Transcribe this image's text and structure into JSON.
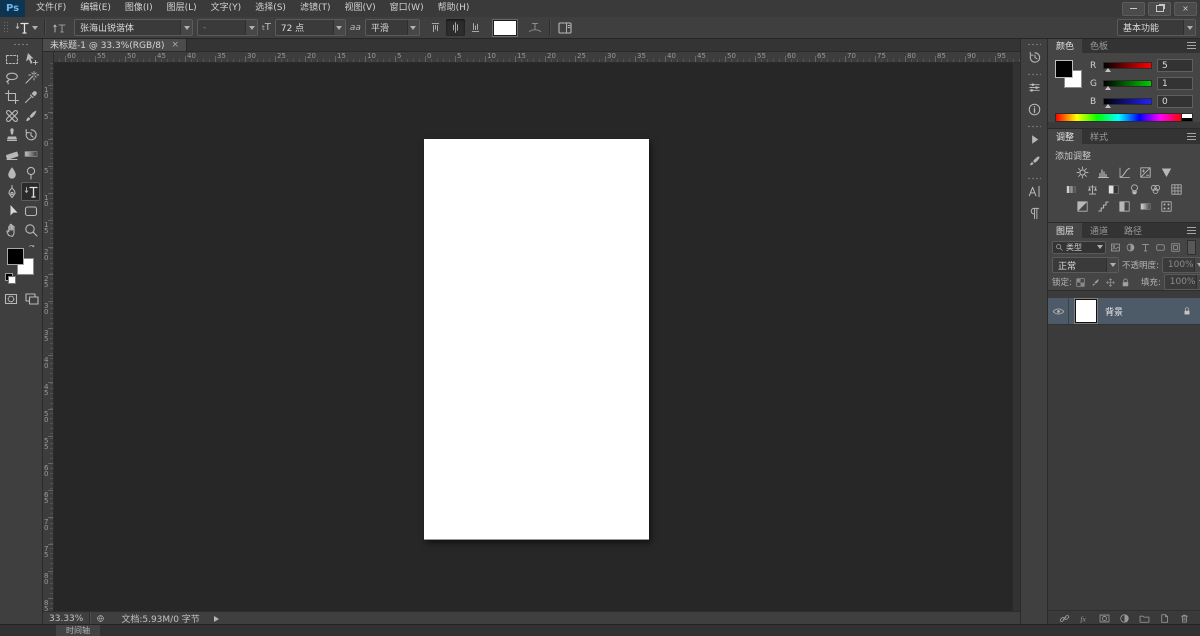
{
  "titlebar": {
    "logo": "Ps",
    "menus": [
      "文件(F)",
      "编辑(E)",
      "图像(I)",
      "图层(L)",
      "文字(Y)",
      "选择(S)",
      "滤镜(T)",
      "视图(V)",
      "窗口(W)",
      "帮助(H)"
    ],
    "window_buttons": [
      "minimize-icon",
      "restore-icon",
      "close-icon"
    ]
  },
  "options_bar": {
    "tool_icon": "type",
    "font_family": "张海山锐谐体",
    "font_style": "-",
    "size_icon_label": "tT",
    "font_size": "72 点",
    "anti_alias_icon_label": "aa",
    "anti_alias": "平滑",
    "alignment_icons": [
      "align-top-icon",
      "align-center-icon",
      "align-bottom-icon"
    ],
    "text_color": "#ffffff",
    "workspace": "基本功能"
  },
  "document_tab": {
    "title": "未标题-1 @ 33.3%(RGB/8)",
    "close_label": "×"
  },
  "toolbar": {
    "tools": [
      {
        "name": "rectangular-marquee"
      },
      {
        "name": "move"
      },
      {
        "name": "lasso"
      },
      {
        "name": "magic-wand"
      },
      {
        "name": "crop"
      },
      {
        "name": "eyedropper"
      },
      {
        "name": "healing-brush"
      },
      {
        "name": "brush"
      },
      {
        "name": "clone-stamp"
      },
      {
        "name": "history-brush"
      },
      {
        "name": "eraser"
      },
      {
        "name": "gradient"
      },
      {
        "name": "blur"
      },
      {
        "name": "dodge"
      },
      {
        "name": "pen"
      },
      {
        "name": "type",
        "active": true
      },
      {
        "name": "path-selection"
      },
      {
        "name": "shape"
      },
      {
        "name": "hand"
      },
      {
        "name": "zoom"
      }
    ],
    "foreground_color": "#000000",
    "background_color": "#ffffff",
    "extra": [
      "quick-mask",
      "screen-mode"
    ]
  },
  "rulers": {
    "horizontal": [
      "60",
      "55",
      "50",
      "45",
      "40",
      "35",
      "30",
      "25",
      "20",
      "15",
      "10",
      "5",
      "0",
      "5",
      "10",
      "15",
      "20",
      "25",
      "30",
      "35",
      "40",
      "45",
      "50",
      "55",
      "60",
      "65",
      "70",
      "75",
      "80",
      "85",
      "90",
      "95"
    ],
    "vertical": [
      "10",
      "5",
      "0",
      "5",
      "10",
      "15",
      "20",
      "25",
      "30",
      "35",
      "40",
      "45",
      "50",
      "55",
      "60",
      "65",
      "70",
      "75",
      "80",
      "85"
    ]
  },
  "dock_groups": [
    [
      "history"
    ],
    [
      "properties",
      "info"
    ],
    [
      "actions",
      "tool-presets"
    ],
    [
      "character",
      "paragraph"
    ]
  ],
  "panels": {
    "color": {
      "tabs": [
        "颜色",
        "色板"
      ],
      "channels": [
        {
          "label": "R",
          "value": "5",
          "track": "red"
        },
        {
          "label": "G",
          "value": "1",
          "track": "green"
        },
        {
          "label": "B",
          "value": "0",
          "track": "blue"
        }
      ]
    },
    "adjustments": {
      "tabs": [
        "调整",
        "样式"
      ],
      "title": "添加调整",
      "icon_rows": [
        [
          "brightness-contrast",
          "levels",
          "curves",
          "exposure",
          "vibrance"
        ],
        [
          "hue-saturation",
          "color-balance",
          "black-white",
          "photo-filter",
          "channel-mixer",
          "color-lookup"
        ],
        [
          "invert",
          "posterize",
          "threshold",
          "gradient-map",
          "selective-color"
        ]
      ]
    },
    "layers": {
      "tabs": [
        "图层",
        "通道",
        "路径"
      ],
      "filter_label": "类型",
      "filter_icons": [
        "kind-pixel",
        "kind-adjustment",
        "kind-type",
        "kind-shape",
        "kind-smartobject"
      ],
      "blend_mode": "正常",
      "opacity_label": "不透明度:",
      "opacity_value": "100%",
      "lock_label": "锁定:",
      "lock_icons": [
        "lock-transparency",
        "lock-pixels",
        "lock-position",
        "lock-all"
      ],
      "fill_label": "填充:",
      "fill_value": "100%",
      "items": [
        {
          "name": "背景",
          "visible": true,
          "locked": true,
          "selected": true
        }
      ],
      "bottom_icons": [
        "link-layers",
        "layer-style",
        "add-mask",
        "new-adjustment",
        "new-group",
        "new-layer",
        "delete-layer"
      ]
    }
  },
  "status_bar": {
    "zoom": "33.33%",
    "doc_info": "文档:5.93M/0 字节"
  },
  "bottom_strip": {
    "timeline_tab": "时间轴"
  },
  "colors": {
    "accent_blue": "#31a8ff",
    "selected_layer": "#4d5a67",
    "canvas_bg": "#272727"
  }
}
